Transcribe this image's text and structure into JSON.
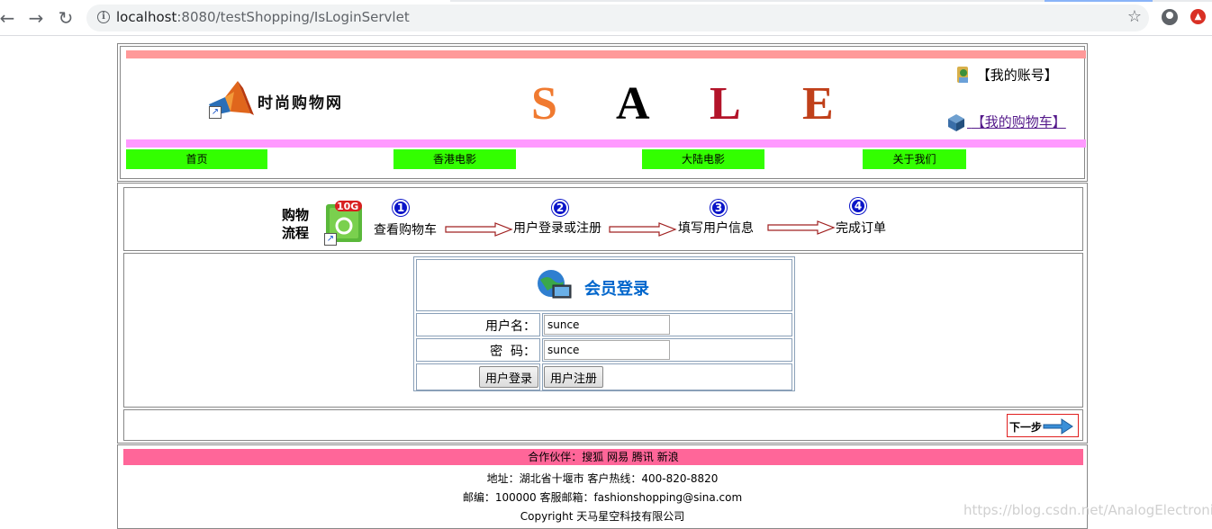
{
  "browser": {
    "url_host": "localhost",
    "url_rest": ":8080/testShopping/IsLoginServlet"
  },
  "header": {
    "logo_text": "时尚购物网",
    "sale_letters": [
      {
        "letter": "S",
        "color": "#f07a30"
      },
      {
        "letter": "A",
        "color": "#000000"
      },
      {
        "letter": "L",
        "color": "#b3142a"
      },
      {
        "letter": "E",
        "color": "#c0401a"
      }
    ],
    "account_link": "【我的账号】",
    "cart_link": "【我的购物车】",
    "nav": [
      "首页",
      "香港电影",
      "大陆电影",
      "关于我们"
    ]
  },
  "flow": {
    "title_line1": "购物",
    "title_line2": "流程",
    "bin_badge": "10G",
    "steps": [
      {
        "num": "1",
        "label": "查看购物车"
      },
      {
        "num": "2",
        "label": "用户登录或注册"
      },
      {
        "num": "3",
        "label": "填写用户信息"
      },
      {
        "num": "4",
        "label": "完成订单"
      }
    ]
  },
  "login": {
    "title": "会员登录",
    "username_label": "用户名：",
    "username_value": "sunce",
    "password_label": "密  码：",
    "password_value": "sunce",
    "login_button": "用户登录",
    "register_button": "用户注册"
  },
  "next": {
    "label": "下一步"
  },
  "footer": {
    "partners": "合作伙伴：搜狐 网易 腾讯 新浪",
    "address": "地址：湖北省十堰市 客户热线：400-820-8820",
    "postal": "邮编：100000 客服邮箱：fashionshopping@sina.com",
    "copyright": "Copyright 天马星空科技有限公司"
  },
  "watermark": "https://blog.csdn.net/AnalogElectronic"
}
